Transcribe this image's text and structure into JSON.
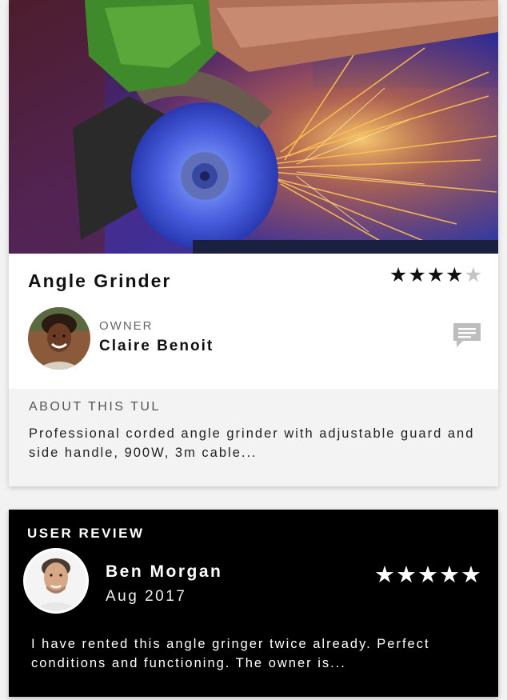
{
  "tool": {
    "title": "Angle Grinder",
    "rating": 4,
    "rating_max": 5,
    "hero_image": "angle grinder cutting metal with sparks",
    "owner": {
      "role_label": "OWNER",
      "name": "Claire Benoit",
      "avatar": "owner-avatar-photo"
    },
    "message_icon": "chat-bubble-icon",
    "about": {
      "heading": "ABOUT THIS TUL",
      "text": "Professional corded angle grinder with adjustable guard and side handle, 900W, 3m cable..."
    }
  },
  "review": {
    "heading": "USER REVIEW",
    "reviewer": {
      "name": "Ben Morgan",
      "date": "Aug 2017",
      "avatar": "reviewer-avatar-photo"
    },
    "rating": 5,
    "rating_max": 5,
    "text": "I have rented this angle gringer twice already. Perfect conditions and functioning. The owner is..."
  },
  "colors": {
    "star_on": "#111111",
    "star_off": "#c4c4c4",
    "review_background": "#000000",
    "about_background": "#f3f3f3"
  }
}
